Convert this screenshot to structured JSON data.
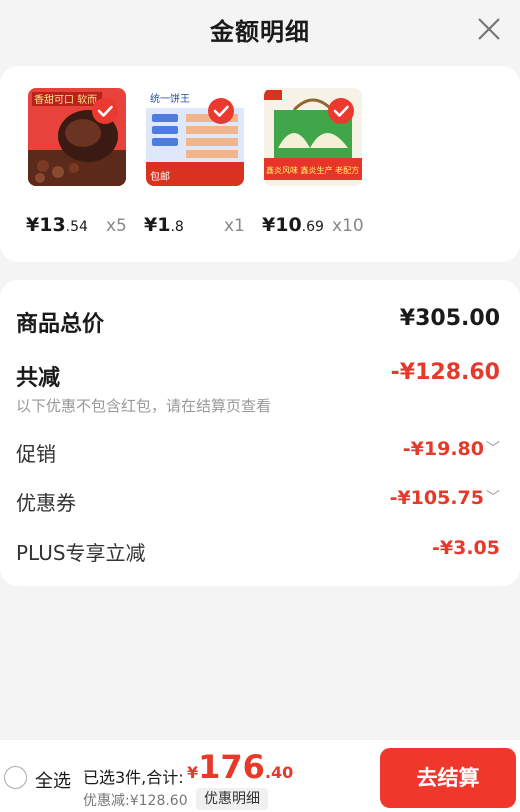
{
  "header": {
    "title": "金额明细"
  },
  "products": [
    {
      "price_int": "¥13",
      "price_dec": ".54",
      "qty": "x5",
      "image_text": "香甜可口 软而"
    },
    {
      "price_int": "¥1",
      "price_dec": ".8",
      "qty": "x1",
      "image_text_top": "统一饼王",
      "image_text_bottom": "包邮"
    },
    {
      "price_int": "¥10",
      "price_dec": ".69",
      "qty": "x10",
      "image_text": "鑫炎风味 鑫炎生产 老配方 老味道"
    }
  ],
  "summary": {
    "total_label": "商品总价",
    "total_value": "¥305.00",
    "reduce_label": "共减",
    "reduce_value": "-¥128.60",
    "reduce_note": "以下优惠不包含红包，请在结算页查看",
    "promo_label": "促销",
    "promo_value": "-¥19.80",
    "coupon_label": "优惠券",
    "coupon_value": "-¥105.75",
    "plus_label": "PLUS专享立减",
    "plus_value": "-¥3.05"
  },
  "bottom_bar": {
    "select_all": "全选",
    "selected_info": "已选3件,合计:",
    "total_yen": "¥",
    "total_int": "176",
    "total_dec": ".40",
    "discount": "优惠减:¥128.60",
    "detail_button": "优惠明细",
    "checkout_button": "去结算"
  },
  "colors": {
    "accent_red": "#e53a2b",
    "button_red": "#f0372c"
  },
  "icons": [
    "close-icon",
    "check-icon",
    "chevron-down-icon",
    "radio-icon"
  ]
}
